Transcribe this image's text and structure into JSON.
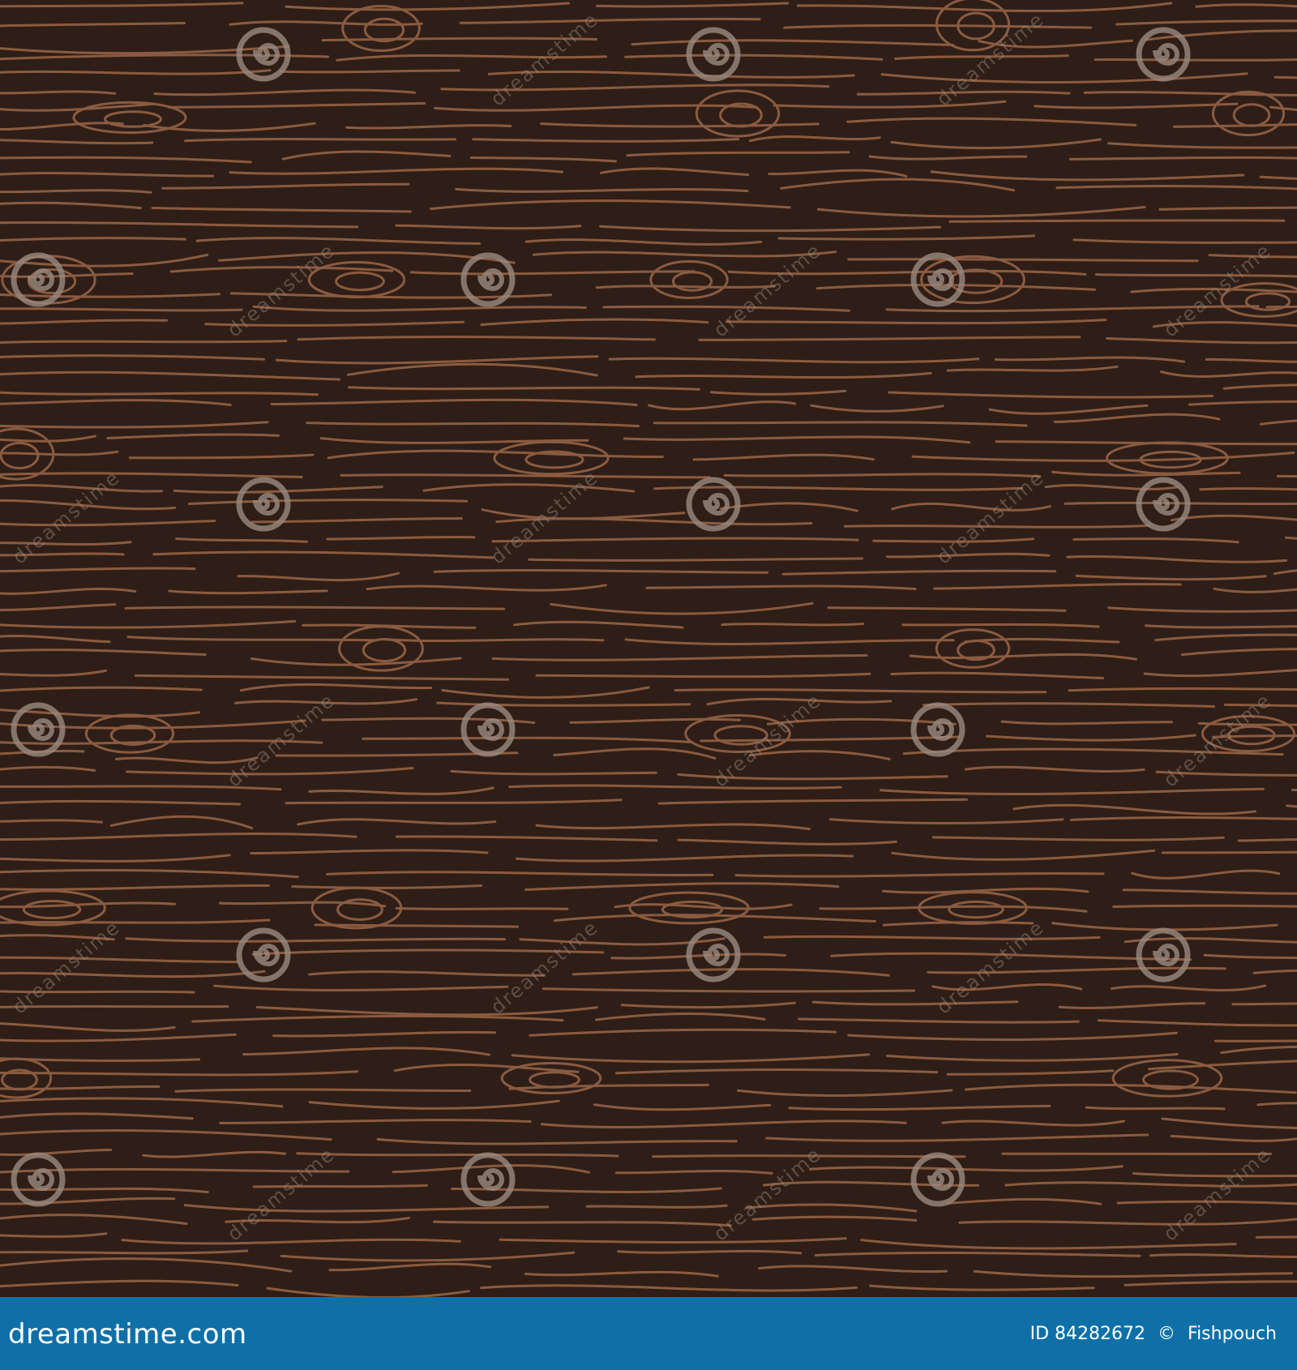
{
  "image": {
    "subject": "seamless hand-drawn wood grain pattern",
    "background_color": "#2e1e17",
    "line_color": "#8a5b40"
  },
  "watermark": {
    "text": "dreamstime",
    "icon": "spiral-logo-icon",
    "color": "#9a8a7f"
  },
  "footer": {
    "background_color": "#0f70a8",
    "logo_text": "dreamstime.com",
    "id_text": "ID 84282672",
    "copyright_symbol": "©",
    "author": "Fishpouch"
  }
}
